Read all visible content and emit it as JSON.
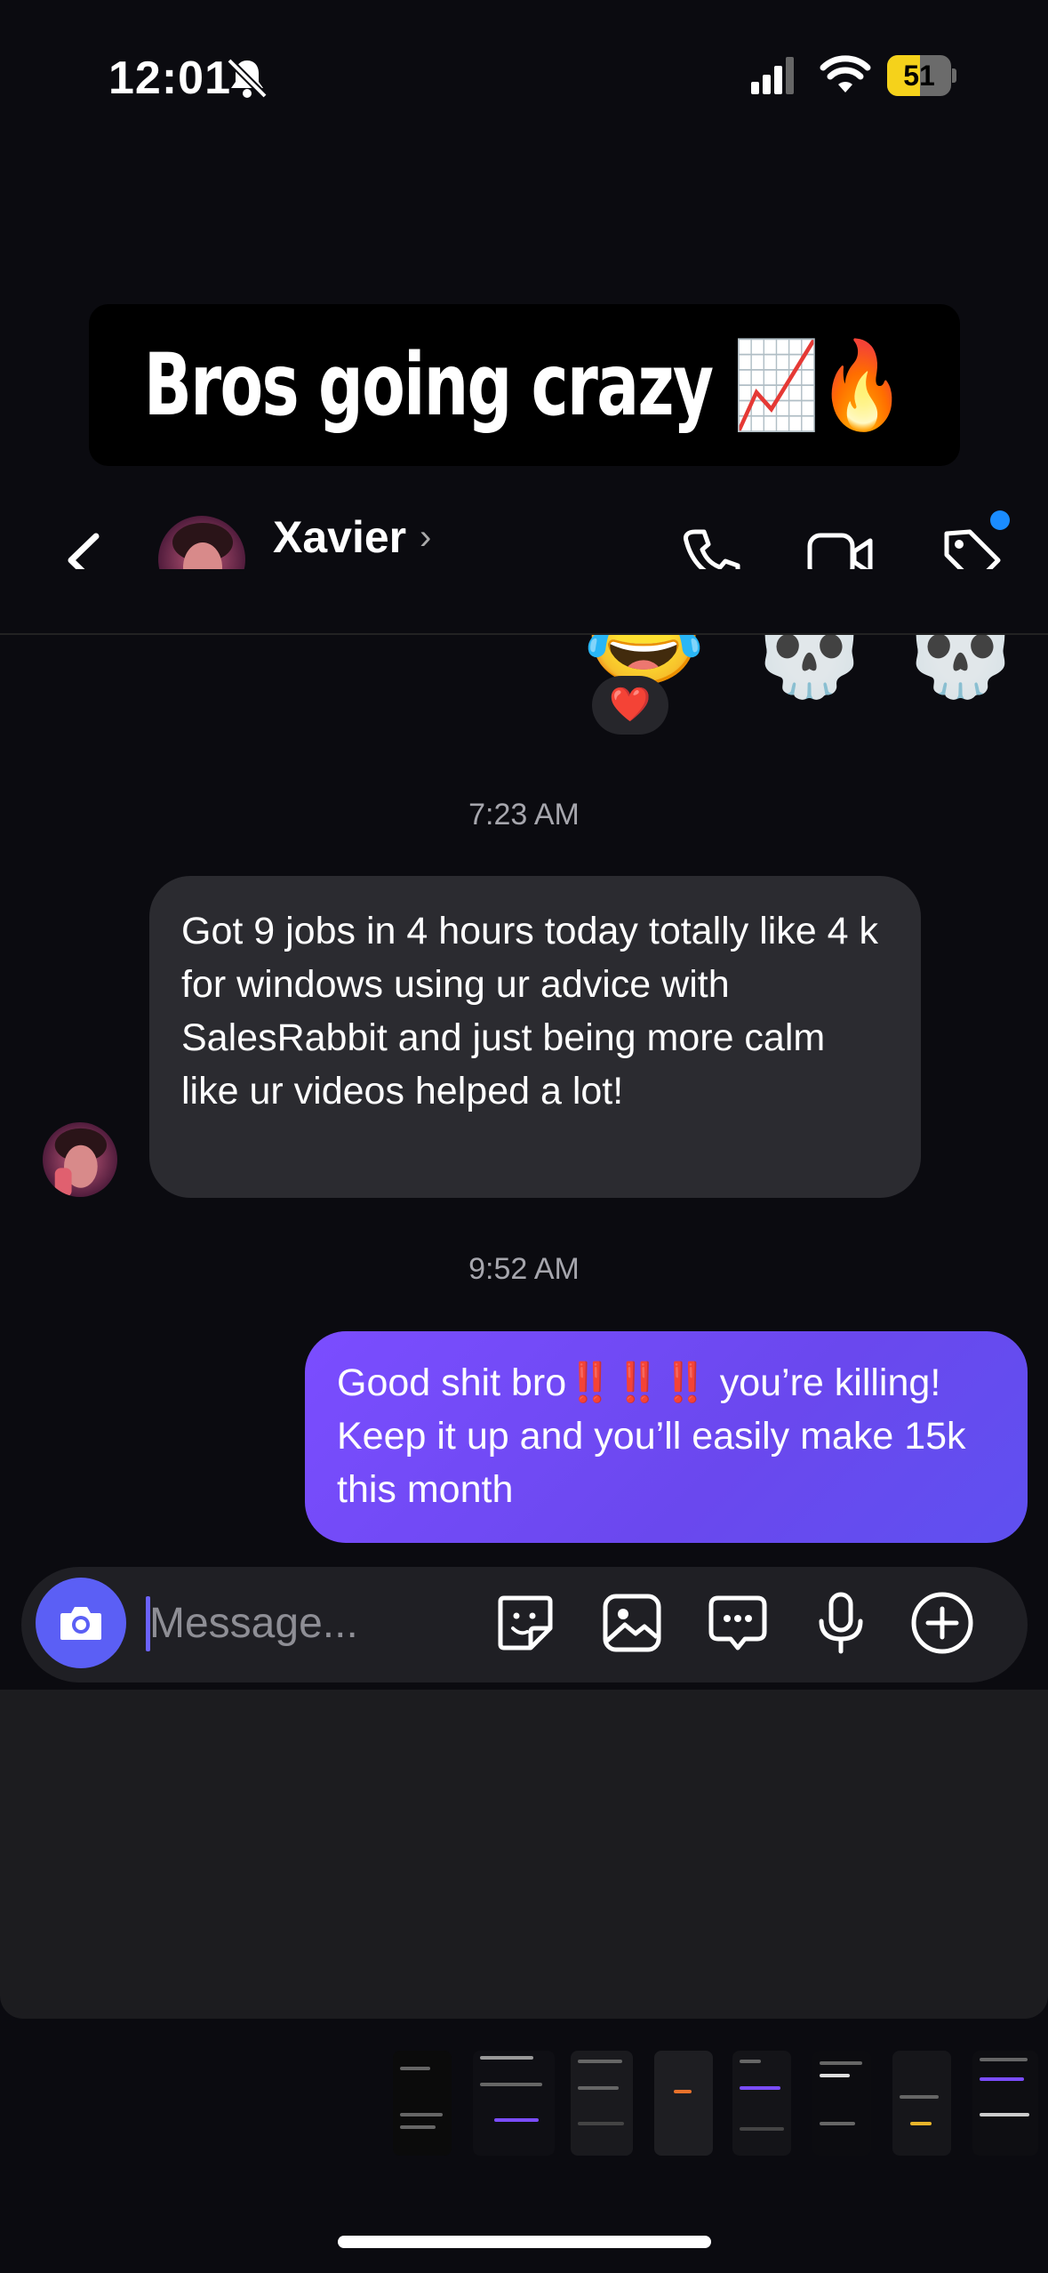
{
  "status_bar": {
    "time": "12:01",
    "battery_level": "51",
    "battery_fraction": 0.51,
    "icons": [
      "bell-slash-icon",
      "signal-icon",
      "wifi-icon",
      "battery-icon"
    ]
  },
  "caption": {
    "text": "Bros going crazy 📈🔥"
  },
  "header": {
    "contact_name": "Xavier",
    "chevron": "›",
    "icons": [
      "back-icon",
      "phone-icon",
      "video-icon",
      "tag-icon"
    ],
    "notification_dot_color": "#1a8cff"
  },
  "reactions_strip": {
    "emojis": [
      "😂",
      "💀",
      "💀"
    ],
    "heart": "❤️"
  },
  "messages": [
    {
      "timestamp": "7:23 AM",
      "direction": "incoming",
      "text": "Got 9 jobs in 4 hours today totally like 4 k  for windows using ur advice with SalesRabbit and just being more calm like ur videos helped a lot!"
    },
    {
      "timestamp": "9:52 AM",
      "direction": "outgoing",
      "text": "Good shit bro‼️‼️‼️ you’re killing! Keep it up and you’ll easily make 15k this month"
    }
  ],
  "composer": {
    "placeholder": "Message...",
    "accent": "#5b5ff5",
    "tools": [
      "camera-icon",
      "sticker-icon",
      "gallery-icon",
      "chat-bubble-icon",
      "microphone-icon",
      "plus-icon"
    ]
  },
  "colors": {
    "background": "#0b0b10",
    "incoming_bubble": "#2b2b30",
    "outgoing_bubble": "#7b4dff"
  }
}
